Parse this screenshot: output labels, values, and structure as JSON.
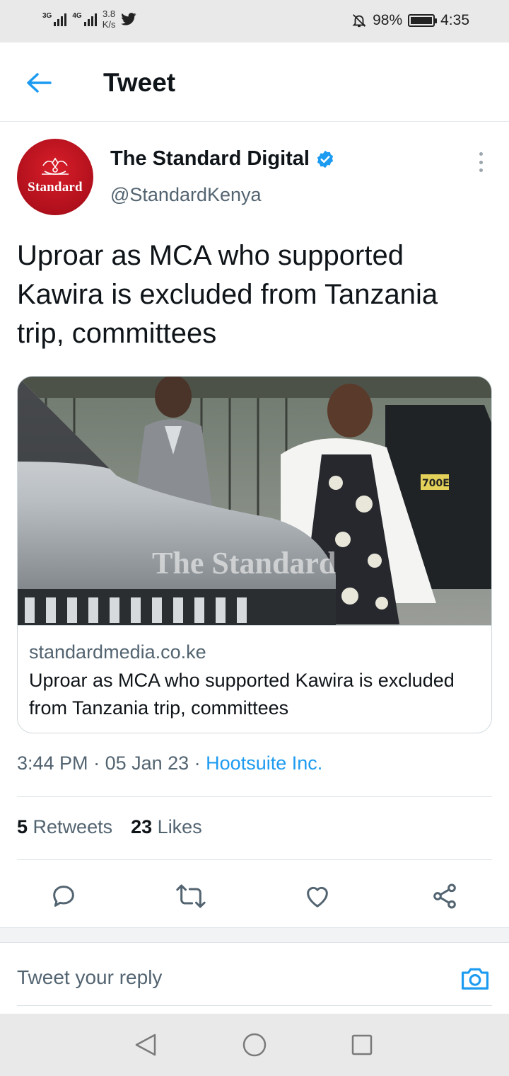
{
  "status_bar": {
    "network_1": "3G",
    "network_2": "4G",
    "speed_value": "3.8",
    "speed_unit": "K/s",
    "battery": "98%",
    "battery_level": 0.98,
    "time": "4:35",
    "icons": [
      "signal-icon",
      "twitter-icon",
      "mute-bell-icon",
      "battery-icon"
    ]
  },
  "header": {
    "title": "Tweet",
    "back_icon": "back-arrow-icon"
  },
  "author": {
    "display_name": "The Standard Digital",
    "handle": "@StandardKenya",
    "verified": true,
    "avatar_text": "Standard",
    "avatar_color": "#c8131f"
  },
  "tweet": {
    "text": "Uproar as MCA who supported Kawira is excluded from Tanzania trip, committees"
  },
  "link_card": {
    "domain": "standardmedia.co.ke",
    "title": "Uproar as MCA who supported Kawira is excluded from Tanzania trip, committees",
    "image_watermark": "The Standard",
    "image_plate": "700E"
  },
  "meta": {
    "time": "3:44 PM",
    "separator": " · ",
    "date": "05 Jan 23",
    "source": "Hootsuite Inc."
  },
  "stats": {
    "retweets_count": "5",
    "retweets_label": "Retweets",
    "likes_count": "23",
    "likes_label": "Likes"
  },
  "actions": [
    "reply-icon",
    "retweet-icon",
    "like-icon",
    "share-icon"
  ],
  "reply": {
    "placeholder": "Tweet your reply"
  },
  "colors": {
    "accent": "#1d9bf0",
    "text": "#0f1419",
    "secondary": "#536471",
    "border": "#cfd9de"
  }
}
